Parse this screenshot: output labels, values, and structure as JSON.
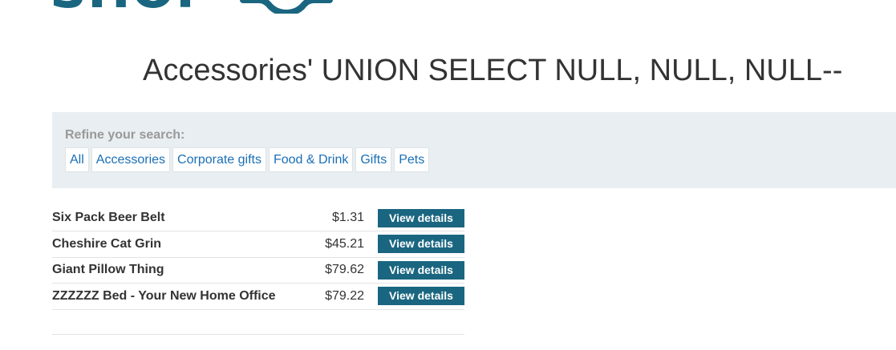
{
  "logo": {
    "text": "SHOP"
  },
  "page_title": "Accessories' UNION SELECT NULL, NULL, NULL--",
  "filter": {
    "heading": "Refine your search:",
    "categories": [
      "All",
      "Accessories",
      "Corporate gifts",
      "Food & Drink",
      "Gifts",
      "Pets"
    ]
  },
  "products": [
    {
      "name": "Six Pack Beer Belt",
      "price": "$1.31",
      "action": "View details"
    },
    {
      "name": "Cheshire Cat Grin",
      "price": "$45.21",
      "action": "View details"
    },
    {
      "name": "Giant Pillow Thing",
      "price": "$79.62",
      "action": "View details"
    },
    {
      "name": "ZZZZZZ Bed - Your New Home Office",
      "price": "$79.22",
      "action": "View details"
    }
  ],
  "colors": {
    "brand": "#1a6680",
    "link": "#1a6fb5",
    "filter_bg": "#e8eef1"
  }
}
